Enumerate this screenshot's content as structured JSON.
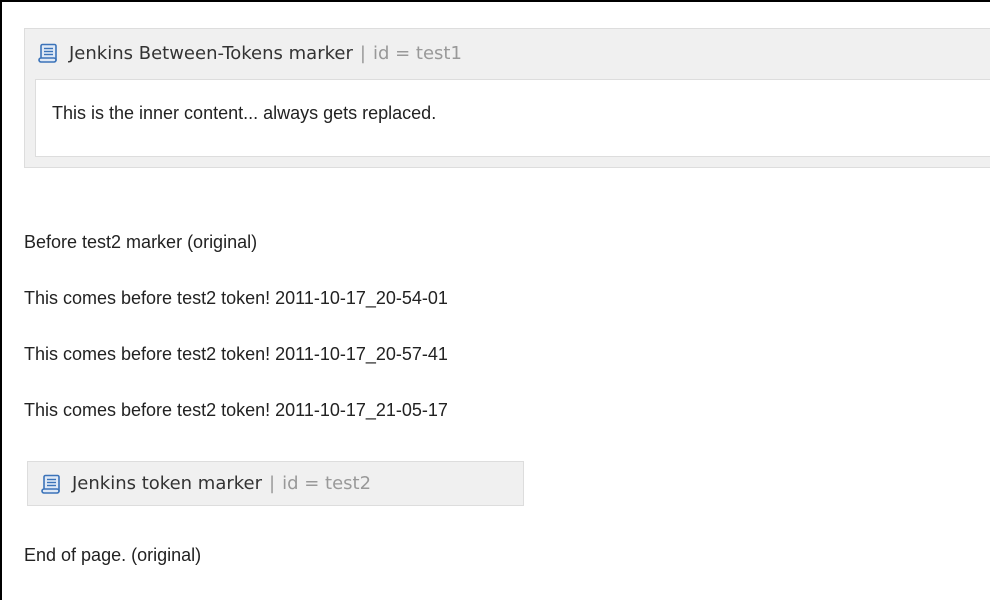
{
  "macro_between": {
    "title": "Jenkins Between-Tokens marker",
    "separator": "|",
    "param": "id = test1",
    "icon": "scroll-icon",
    "body_text": "This is the inner content... always gets replaced."
  },
  "content": {
    "lines": [
      "Before test2 marker (original)",
      "This comes before test2 token! 2011-10-17_20-54-01",
      "This comes before test2 token! 2011-10-17_20-57-41",
      "This comes before test2 token! 2011-10-17_21-05-17"
    ],
    "end_line": "End of page. (original)"
  },
  "macro_token": {
    "title": "Jenkins token marker",
    "separator": "|",
    "param": "id = test2",
    "icon": "scroll-icon"
  },
  "colors": {
    "panel_bg": "#f0f0f0",
    "panel_border": "#dddddd",
    "icon_blue": "#3b73b9",
    "muted_text": "#999999"
  }
}
